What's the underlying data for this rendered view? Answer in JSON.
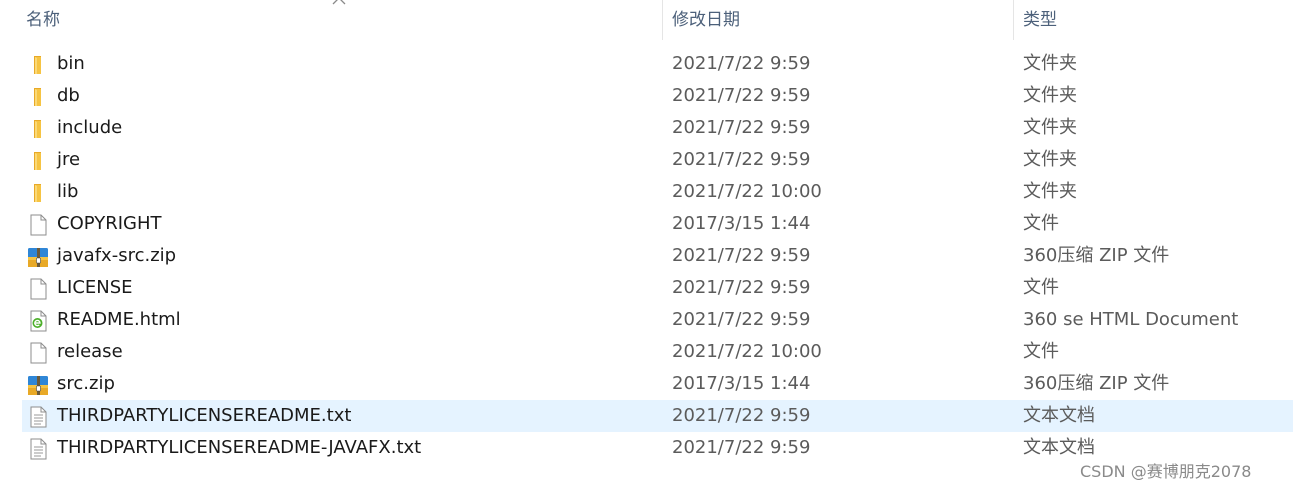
{
  "header": {
    "name_label": "名称",
    "date_label": "修改日期",
    "type_label": "类型"
  },
  "files": [
    {
      "name": "bin",
      "date": "2021/7/22 9:59",
      "type": "文件夹",
      "icon": "folder-icon"
    },
    {
      "name": "db",
      "date": "2021/7/22 9:59",
      "type": "文件夹",
      "icon": "folder-icon"
    },
    {
      "name": "include",
      "date": "2021/7/22 9:59",
      "type": "文件夹",
      "icon": "folder-icon"
    },
    {
      "name": "jre",
      "date": "2021/7/22 9:59",
      "type": "文件夹",
      "icon": "folder-icon"
    },
    {
      "name": "lib",
      "date": "2021/7/22 10:00",
      "type": "文件夹",
      "icon": "folder-icon"
    },
    {
      "name": "COPYRIGHT",
      "date": "2017/3/15 1:44",
      "type": "文件",
      "icon": "blank-file-icon"
    },
    {
      "name": "javafx-src.zip",
      "date": "2021/7/22 9:59",
      "type": "360压缩 ZIP 文件",
      "icon": "zip-archive-icon"
    },
    {
      "name": "LICENSE",
      "date": "2021/7/22 9:59",
      "type": "文件",
      "icon": "blank-file-icon"
    },
    {
      "name": "README.html",
      "date": "2021/7/22 9:59",
      "type": "360 se HTML Document",
      "icon": "html-file-icon"
    },
    {
      "name": "release",
      "date": "2021/7/22 10:00",
      "type": "文件",
      "icon": "blank-file-icon"
    },
    {
      "name": "src.zip",
      "date": "2017/3/15 1:44",
      "type": "360压缩 ZIP 文件",
      "icon": "zip-archive-icon"
    },
    {
      "name": "THIRDPARTYLICENSEREADME.txt",
      "date": "2021/7/22 9:59",
      "type": "文本文档",
      "icon": "text-file-icon",
      "selected": true
    },
    {
      "name": "THIRDPARTYLICENSEREADME-JAVAFX.txt",
      "date": "2021/7/22 9:59",
      "type": "文本文档",
      "icon": "text-file-icon"
    }
  ],
  "colors": {
    "selection": "#e5f3ff",
    "header_text": "#4c607a",
    "folder": "#f6c443"
  },
  "watermark": "CSDN @赛博朋克2078"
}
